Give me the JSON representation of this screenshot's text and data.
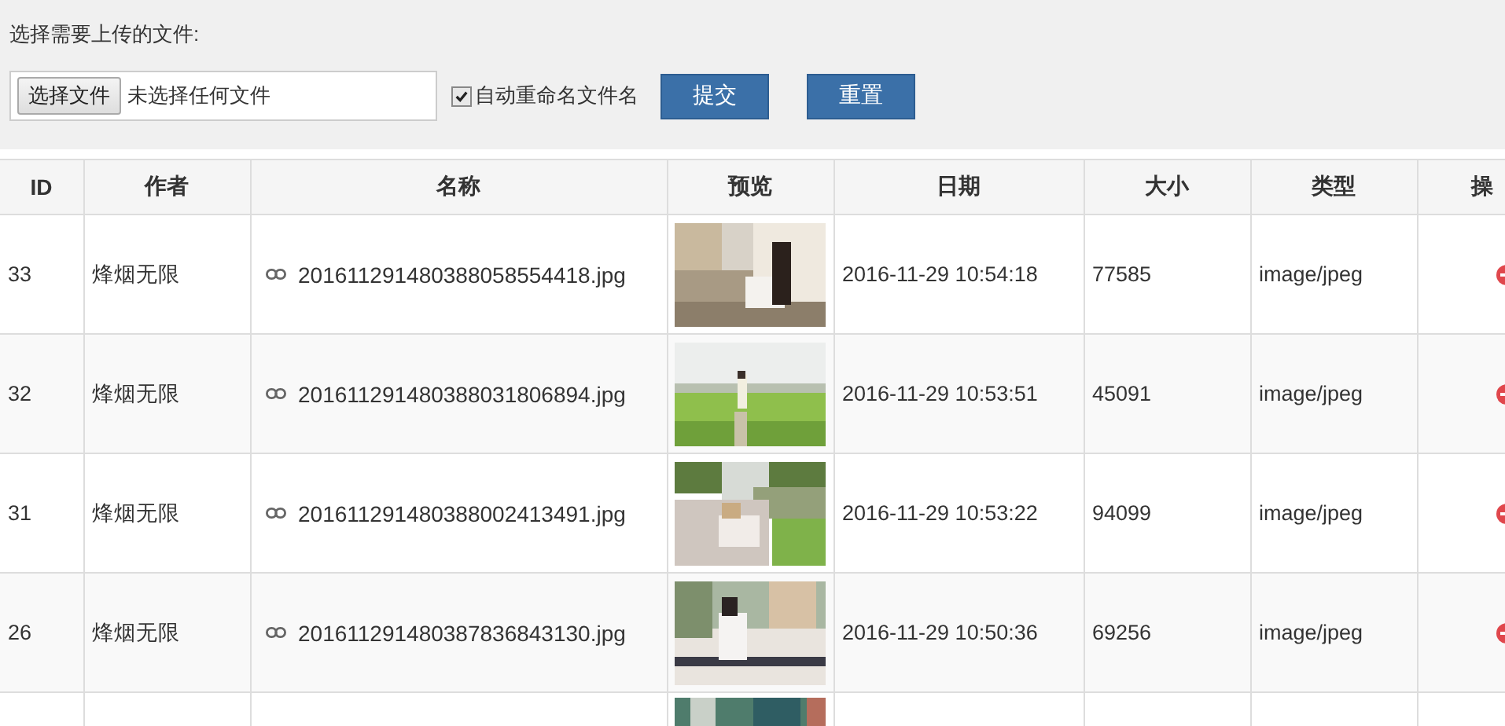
{
  "upload_form": {
    "prompt": "选择需要上传的文件:",
    "file_button": "选择文件",
    "file_status": "未选择任何文件",
    "auto_rename": {
      "label": "自动重命名文件名",
      "checked": true
    },
    "buttons": [
      "提交",
      "重置"
    ]
  },
  "table": {
    "columns": [
      "ID",
      "作者",
      "名称",
      "预览",
      "日期",
      "大小",
      "类型",
      "操"
    ],
    "rows": [
      {
        "id": "33",
        "author": "烽烟无限",
        "name": "201611291480388058554418.jpg",
        "date": "2016-11-29 10:54:18",
        "size": "77585",
        "type": "image/jpeg"
      },
      {
        "id": "32",
        "author": "烽烟无限",
        "name": "201611291480388031806894.jpg",
        "date": "2016-11-29 10:53:51",
        "size": "45091",
        "type": "image/jpeg"
      },
      {
        "id": "31",
        "author": "烽烟无限",
        "name": "201611291480388002413491.jpg",
        "date": "2016-11-29 10:53:22",
        "size": "94099",
        "type": "image/jpeg"
      },
      {
        "id": "26",
        "author": "烽烟无限",
        "name": "201611291480387836843130.jpg",
        "date": "2016-11-29 10:50:36",
        "size": "69256",
        "type": "image/jpeg"
      }
    ]
  }
}
